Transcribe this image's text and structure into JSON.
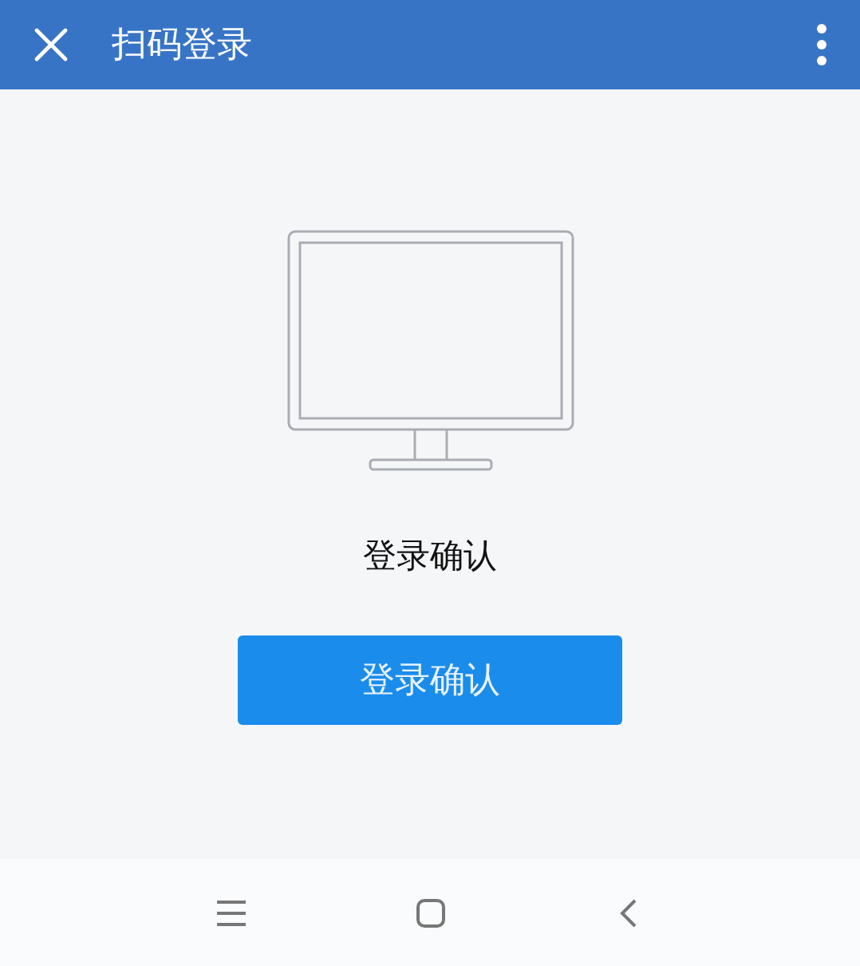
{
  "header": {
    "title": "扫码登录"
  },
  "content": {
    "message": "登录确认",
    "button": "登录确认"
  }
}
